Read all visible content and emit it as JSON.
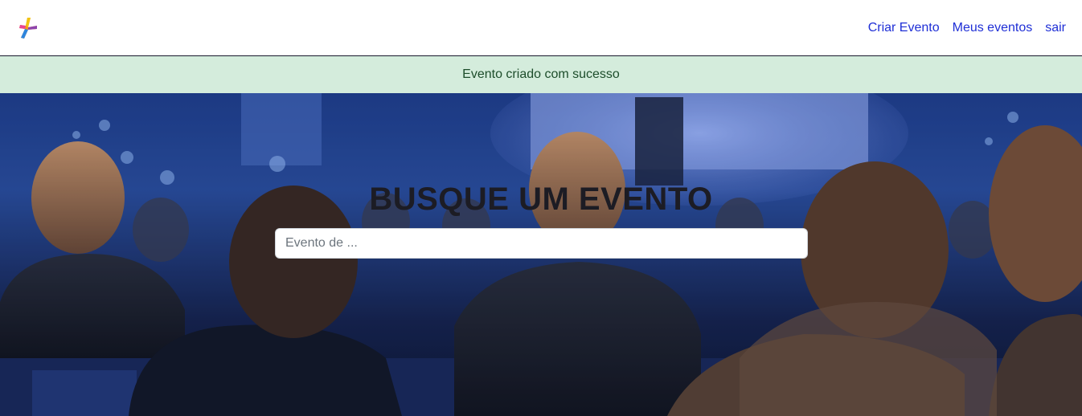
{
  "navbar": {
    "logo_icon": "star-logo-icon",
    "links": [
      {
        "label": "Criar Evento"
      },
      {
        "label": "Meus eventos"
      },
      {
        "label": "sair"
      }
    ],
    "link_color": "#1f2fd6"
  },
  "alert": {
    "message": "Evento criado com sucesso",
    "background": "#d4ecdc"
  },
  "hero": {
    "title": "BUSQUE UM EVENTO",
    "search": {
      "placeholder": "Evento de ...",
      "value": ""
    }
  }
}
